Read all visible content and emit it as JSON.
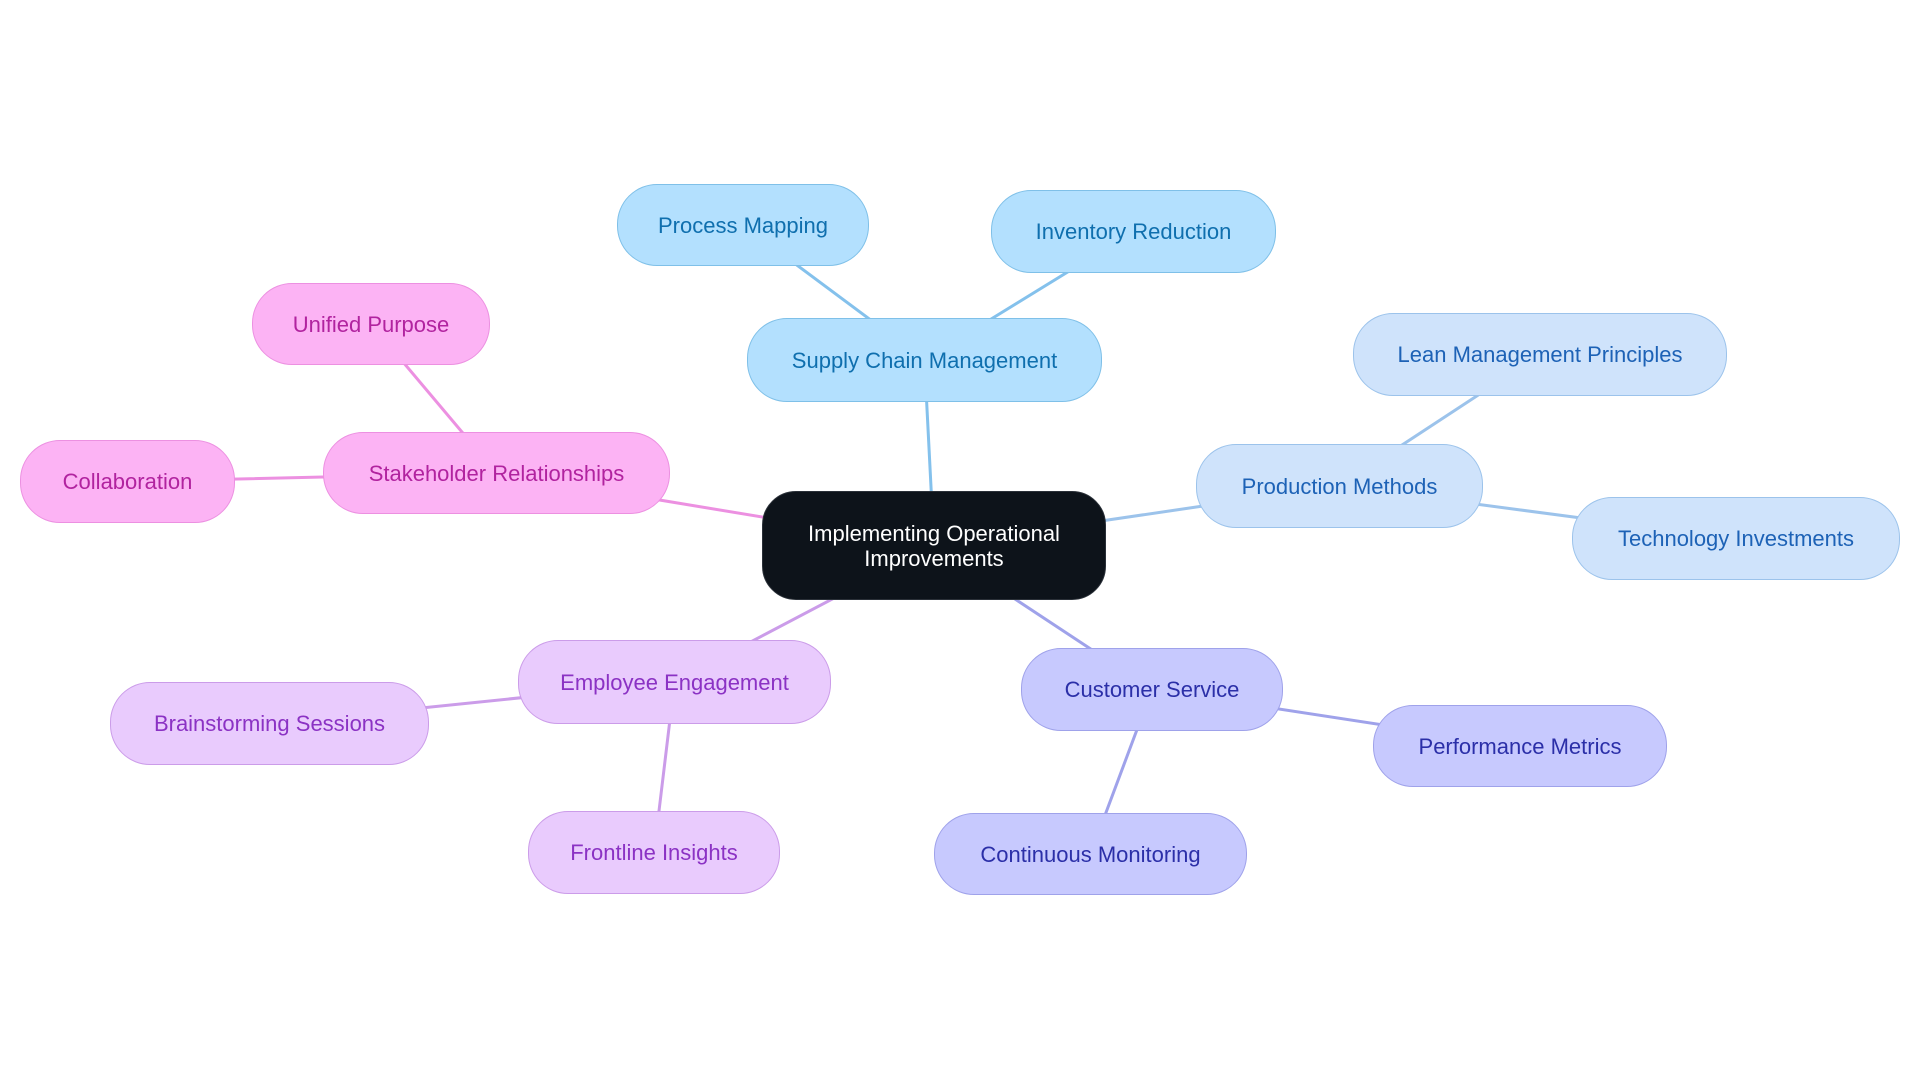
{
  "diagram": {
    "type": "mindmap",
    "root": {
      "id": "root",
      "label": "Implementing Operational Improvements",
      "label_lines": [
        "Implementing Operational",
        "Improvements"
      ],
      "fill": "#0d131a",
      "border": "#2a3038",
      "text": "#ffffff"
    },
    "branches": [
      {
        "id": "supply",
        "label": "Supply Chain Management",
        "theme": "sky",
        "children": [
          {
            "id": "process",
            "label": "Process Mapping"
          },
          {
            "id": "inventory",
            "label": "Inventory Reduction"
          }
        ]
      },
      {
        "id": "production",
        "label": "Production Methods",
        "theme": "blue",
        "children": [
          {
            "id": "lean",
            "label": "Lean Management Principles"
          },
          {
            "id": "tech",
            "label": "Technology Investments"
          }
        ]
      },
      {
        "id": "customer",
        "label": "Customer Service",
        "theme": "indigo",
        "children": [
          {
            "id": "performance",
            "label": "Performance Metrics"
          },
          {
            "id": "monitoring",
            "label": "Continuous Monitoring"
          }
        ]
      },
      {
        "id": "employee",
        "label": "Employee Engagement",
        "theme": "purple",
        "children": [
          {
            "id": "brainstorm",
            "label": "Brainstorming Sessions"
          },
          {
            "id": "frontline",
            "label": "Frontline Insights"
          }
        ]
      },
      {
        "id": "stakeholder",
        "label": "Stakeholder Relationships",
        "theme": "pink",
        "children": [
          {
            "id": "collab",
            "label": "Collaboration"
          },
          {
            "id": "unified",
            "label": "Unified Purpose"
          }
        ]
      }
    ],
    "themes": {
      "sky": {
        "fill": "#b3e0fe",
        "border": "#7fc0e8",
        "text": "#0f6fae",
        "edge": "#84c1ec"
      },
      "blue": {
        "fill": "#cfe3fb",
        "border": "#9cc3eb",
        "text": "#1d62b6",
        "edge": "#9cc3eb"
      },
      "indigo": {
        "fill": "#c7c9fe",
        "border": "#9fa2ea",
        "text": "#2b2fa8",
        "edge": "#9fa2ea"
      },
      "purple": {
        "fill": "#e9cbfd",
        "border": "#cb9ce9",
        "text": "#8b32c4",
        "edge": "#cb9ce9"
      },
      "pink": {
        "fill": "#fcb3f4",
        "border": "#ec90e1",
        "text": "#b1239f",
        "edge": "#ec90e1"
      }
    }
  }
}
